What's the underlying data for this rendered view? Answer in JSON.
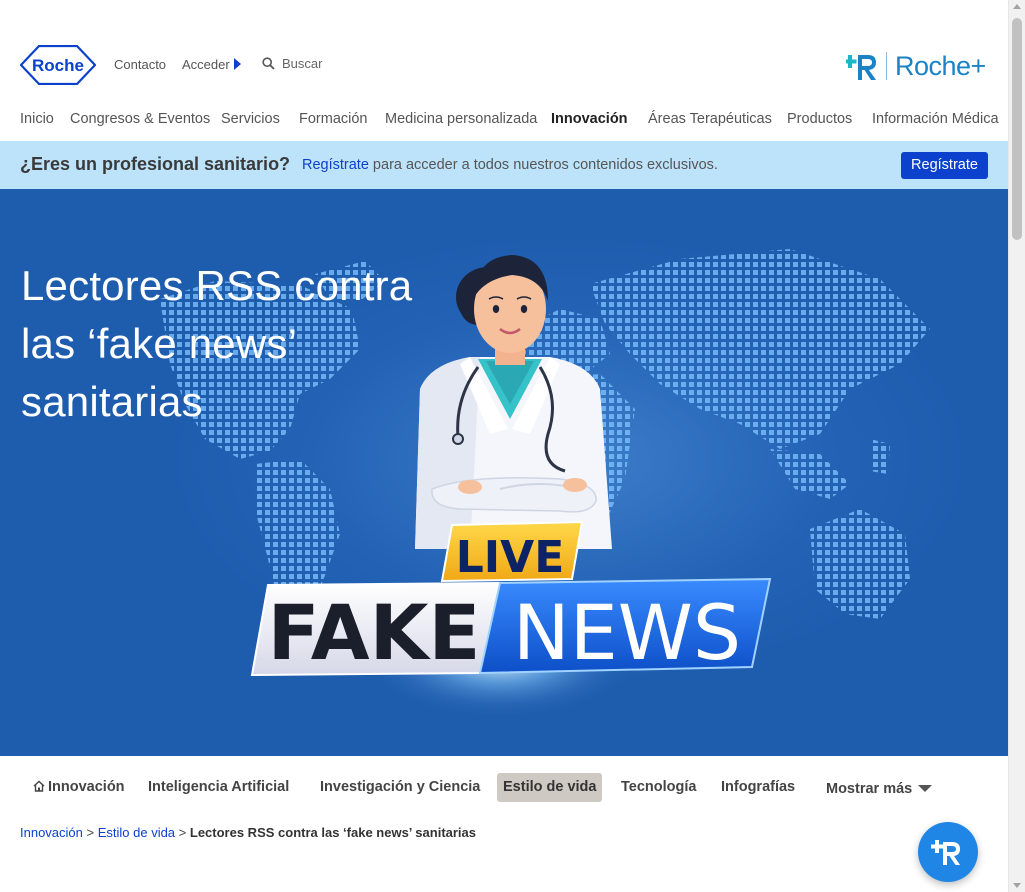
{
  "header": {
    "logo_text": "Roche",
    "contact_label": "Contacto",
    "login_label": "Acceder",
    "search_label": "Buscar",
    "brand_plus_text": "Roche+"
  },
  "nav": {
    "items": [
      {
        "label": "Inicio"
      },
      {
        "label": "Congresos & Eventos"
      },
      {
        "label": "Servicios"
      },
      {
        "label": "Formación"
      },
      {
        "label": "Medicina personalizada"
      },
      {
        "label": "Innovación",
        "active": true
      },
      {
        "label": "Áreas Terapéuticas"
      },
      {
        "label": "Productos"
      },
      {
        "label": "Información Médica"
      }
    ]
  },
  "pro_banner": {
    "question": "¿Eres un profesional sanitario?",
    "link_text": "Regístrate",
    "message": " para acceder a todos nuestros contenidos exclusivos.",
    "button_label": "Regístrate"
  },
  "hero": {
    "title": "Lectores RSS contra las ‘fake news’ sanitarias",
    "badge_live": "LIVE",
    "badge_fake": "FAKE",
    "badge_news": "NEWS"
  },
  "category_tabs": [
    {
      "label": "Innovación",
      "icon": "home-icon"
    },
    {
      "label": "Inteligencia Artificial"
    },
    {
      "label": "Investigación y Ciencia"
    },
    {
      "label": "Estilo de vida",
      "selected": true
    },
    {
      "label": "Tecnología"
    },
    {
      "label": "Infografías"
    },
    {
      "label": "Mostrar más"
    }
  ],
  "breadcrumb": {
    "level1": "Innovación",
    "sep1": " > ",
    "level2": "Estilo de vida",
    "sep2": " > ",
    "current": "Lectores RSS contra las ‘fake news’ sanitarias"
  },
  "colors": {
    "brand_blue": "#0b41cd",
    "banner_bg": "#bde3fb",
    "hero_bg": "#1e5cae",
    "selected_tab_bg": "#cfc9c4",
    "fab_blue": "#1f86e6"
  }
}
